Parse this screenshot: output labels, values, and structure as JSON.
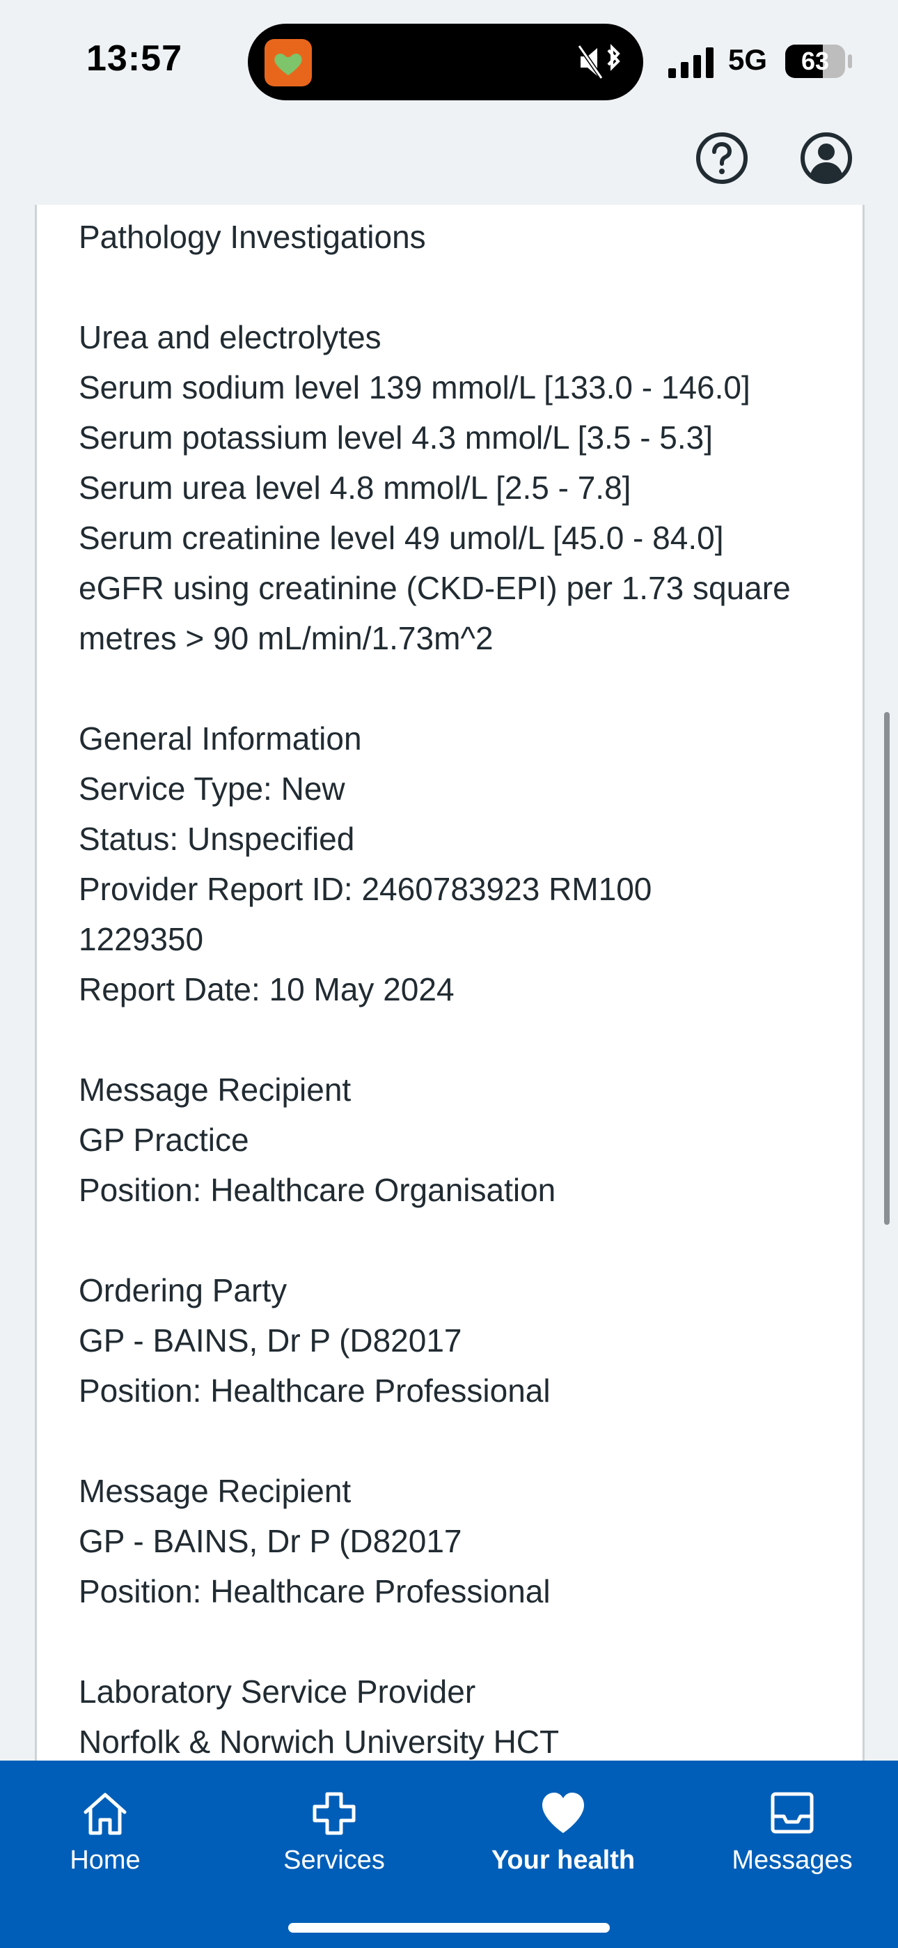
{
  "status_bar": {
    "time": "13:57",
    "network": "5G",
    "battery_percent": "63",
    "battery_level": 0.63,
    "icons": [
      "app-activity-icon",
      "silent-mode-icon",
      "bluetooth-icon",
      "signal-icon",
      "battery-icon"
    ]
  },
  "toolbar": {
    "icons": [
      "help-icon",
      "account-icon"
    ]
  },
  "content": {
    "lines": [
      "Pathology Investigations",
      "",
      "Urea and electrolytes",
      "Serum sodium level 139 mmol/L [133.0 - 146.0]",
      "Serum potassium level 4.3 mmol/L [3.5 - 5.3]",
      "Serum urea level 4.8 mmol/L [2.5 - 7.8]",
      "Serum creatinine level 49 umol/L [45.0 - 84.0]",
      "eGFR using creatinine (CKD-EPI) per 1.73 square",
      "metres > 90 mL/min/1.73m^2",
      "",
      "General Information",
      "Service Type: New",
      "Status: Unspecified",
      "Provider Report ID: 2460783923 RM100",
      "1229350",
      "Report Date: 10 May 2024",
      "",
      "Message Recipient",
      "GP Practice",
      "Position: Healthcare Organisation",
      "",
      "Ordering Party",
      "GP - BAINS, Dr P (D82017",
      "Position: Healthcare Professional",
      "",
      "Message Recipient",
      "GP - BAINS, Dr P (D82017",
      "Position: Healthcare Professional",
      "",
      "Laboratory Service Provider",
      "Norfolk & Norwich University HCT"
    ]
  },
  "bottom_nav": {
    "home": "Home",
    "services": "Services",
    "your_health": "Your health",
    "messages": "Messages",
    "active": "your_health",
    "colors": {
      "background": "#005eb8",
      "text": "#ffffff"
    }
  }
}
